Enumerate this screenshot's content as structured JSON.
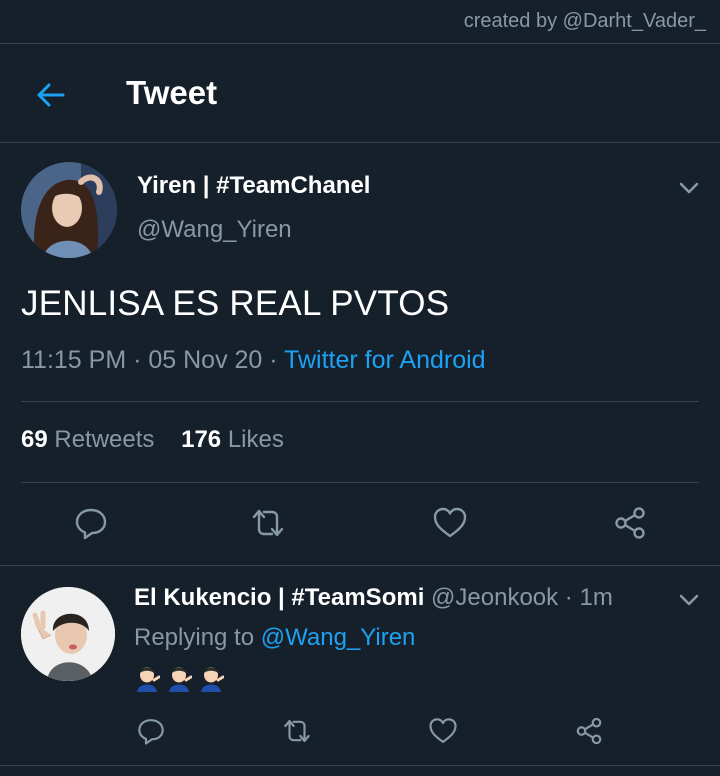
{
  "credit": "created by @Darht_Vader_",
  "header": {
    "title": "Tweet"
  },
  "tweet": {
    "display_name": "Yiren | #TeamChanel",
    "handle": "@Wang_Yiren",
    "text": "JENLISA ES REAL PVTOS",
    "time_date": "11:15 PM · 05 Nov 20 · ",
    "source": "Twitter for Android",
    "retweets_count": "69",
    "retweets_label": "Retweets",
    "likes_count": "176",
    "likes_label": "Likes"
  },
  "reply": {
    "display_name": "El Kukencio | #TeamSomi",
    "handle": "@Jeonkook",
    "time": " · 1m",
    "replying_prefix": "Replying to ",
    "replying_to": "@Wang_Yiren"
  },
  "colors": {
    "background": "#15202b",
    "divider": "#38444d",
    "secondary_text": "#8899a6",
    "accent": "#1da1f2"
  },
  "icons": [
    "back-arrow-icon",
    "chevron-down-icon",
    "reply-icon",
    "retweet-icon",
    "like-icon",
    "share-icon",
    "person-tipping-hand-emoji"
  ]
}
